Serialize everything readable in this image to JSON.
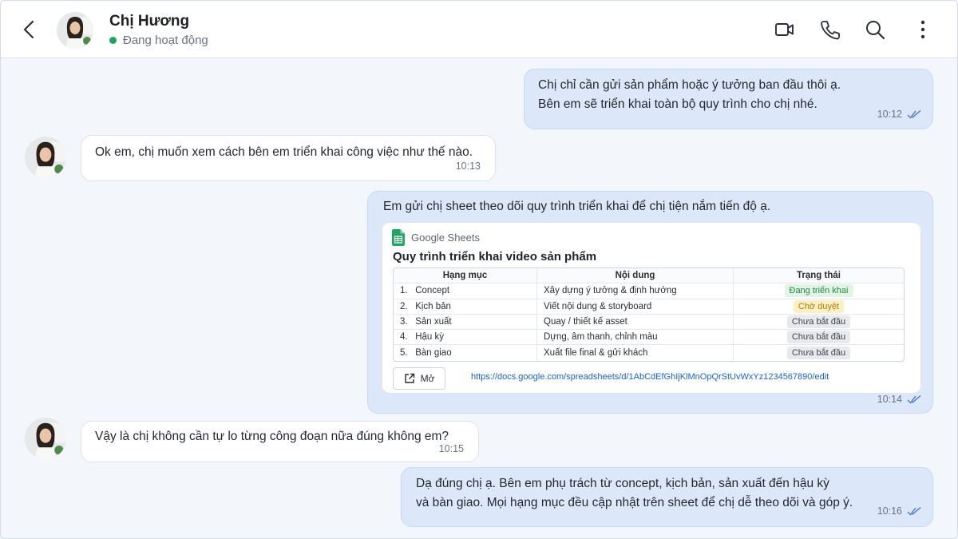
{
  "header": {
    "contact_name": "Chị Hương",
    "status": "Đang hoạt động",
    "status_color": "#1ea362",
    "icons": [
      "back-arrow-icon",
      "video-call-icon",
      "phone-icon",
      "search-icon",
      "more-vertical-icon"
    ]
  },
  "messages": [
    {
      "direction": "out",
      "text": "Chị chỉ cần gửi sản phẩm hoặc ý tưởng ban đầu thôi ạ.\nBên em sẽ triển khai toàn bộ quy trình cho chị nhé.",
      "time": "10:12",
      "read": true
    },
    {
      "direction": "in",
      "text": "Ok em, chị muốn xem cách bên em triển khai công việc như thế nào.",
      "time": "10:13"
    },
    {
      "direction": "out",
      "text": "Em gửi chị sheet theo dõi quy trình triển khai để chị tiện nắm tiến độ ạ.",
      "time": "10:14",
      "read": true
    },
    {
      "direction": "in",
      "text": "Vậy là chị không cần tự lo từng công đoạn nữa đúng không em?",
      "time": "10:15"
    },
    {
      "direction": "out",
      "text": "Dạ đúng chị ạ. Bên em phụ trách từ concept, kịch bản, sản xuất đến hậu kỳ\nvà bàn giao. Mọi hạng mục đều cập nhật trên sheet để chị dễ theo dõi và góp ý.",
      "time": "10:16",
      "read": true
    }
  ],
  "sheet": {
    "app_label": "Google Sheets",
    "title": "Quy trình triển khai video sản phẩm",
    "columns": [
      "Hạng mục",
      "Nội dung",
      "Trạng thái"
    ],
    "rows": [
      {
        "index": "1.",
        "item": "Concept",
        "content": "Xây dựng ý tưởng & định hướng",
        "status": "Đang triển khai",
        "status_kind": "green"
      },
      {
        "index": "2.",
        "item": "Kịch bản",
        "content": "Viết nội dung & storyboard",
        "status": "Chờ duyệt",
        "status_kind": "yellow"
      },
      {
        "index": "3.",
        "item": "Sản xuất",
        "content": "Quay / thiết kế asset",
        "status": "Chưa bắt đầu",
        "status_kind": "gray"
      },
      {
        "index": "4.",
        "item": "Hậu kỳ",
        "content": "Dựng, âm thanh, chỉnh màu",
        "status": "Chưa bắt đầu",
        "status_kind": "gray"
      },
      {
        "index": "5.",
        "item": "Bàn giao",
        "content": "Xuất file final & gửi khách",
        "status": "Chưa bắt đầu",
        "status_kind": "gray"
      }
    ],
    "open_label": "Mở",
    "link": "https://docs.google.com/spreadsheets/d/1AbCdEfGhIjKlMnOpQrStUvWxYz1234567890/edit"
  },
  "colors": {
    "outgoing_bubble": "#dce8f9",
    "incoming_bubble": "#ffffff",
    "background": "#f3f6fb",
    "link": "#1a62d4"
  }
}
